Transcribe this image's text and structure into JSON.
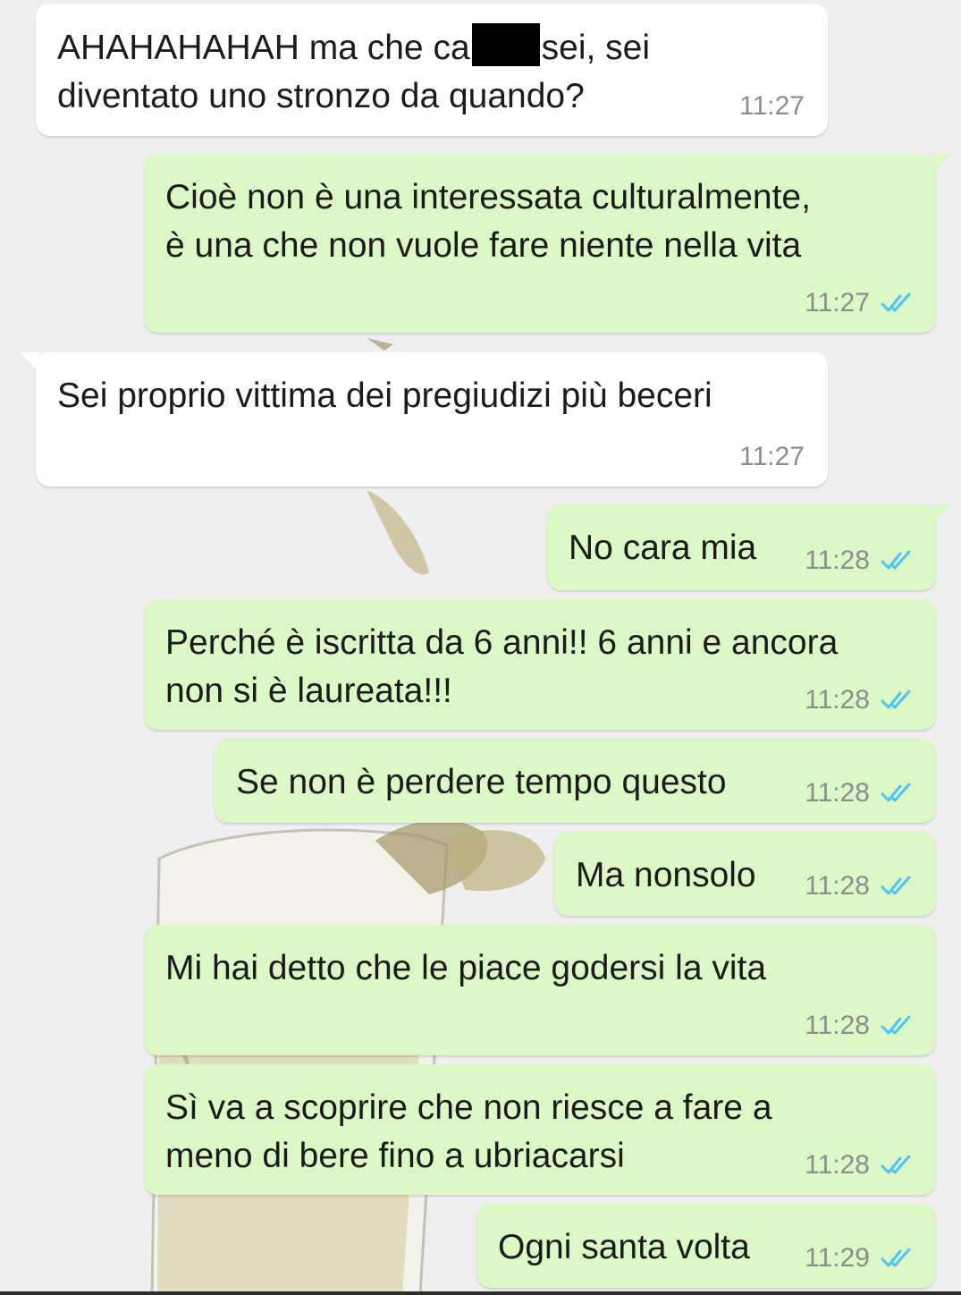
{
  "chat": {
    "messages": [
      {
        "dir": "in",
        "text_before": "AHAHAHAHAH ma che ca",
        "text_after": "sei, sei\ndiventato uno stronzo da quando?",
        "time": "11:27"
      },
      {
        "dir": "out",
        "text": "Cioè non è una interessata culturalmente,\nè una che non vuole fare niente nella vita",
        "time": "11:27",
        "status": "read"
      },
      {
        "dir": "in",
        "text": "Sei proprio vittima dei pregiudizi più beceri",
        "time": "11:27"
      },
      {
        "dir": "out",
        "text": "No cara mia",
        "time": "11:28",
        "status": "read"
      },
      {
        "dir": "out",
        "text": "Perché è iscritta da 6 anni!! 6 anni e ancora\nnon si è laureata!!!",
        "time": "11:28",
        "status": "read"
      },
      {
        "dir": "out",
        "text": "Se non è perdere tempo questo",
        "time": "11:28",
        "status": "read"
      },
      {
        "dir": "out",
        "text": "Ma nonsolo",
        "time": "11:28",
        "status": "read"
      },
      {
        "dir": "out",
        "text": "Mi hai detto che le piace godersi la vita",
        "time": "11:28",
        "status": "read"
      },
      {
        "dir": "out",
        "text": "Sì va a scoprire che non riesce a fare a\nmeno di bere fino a ubriacarsi",
        "time": "11:28",
        "status": "read"
      },
      {
        "dir": "out",
        "text": "Ogni santa volta",
        "time": "11:29",
        "status": "read"
      }
    ]
  },
  "colors": {
    "incoming_bubble": "#ffffff",
    "outgoing_bubble": "#dcf8c6",
    "read_ticks": "#4fc3f7",
    "timestamp": "#8d8d8d",
    "wallpaper_bg": "#efefef"
  },
  "icons": {
    "read_receipt": "double-check-icon",
    "wallpaper": "champagne-glass-wallpaper"
  }
}
